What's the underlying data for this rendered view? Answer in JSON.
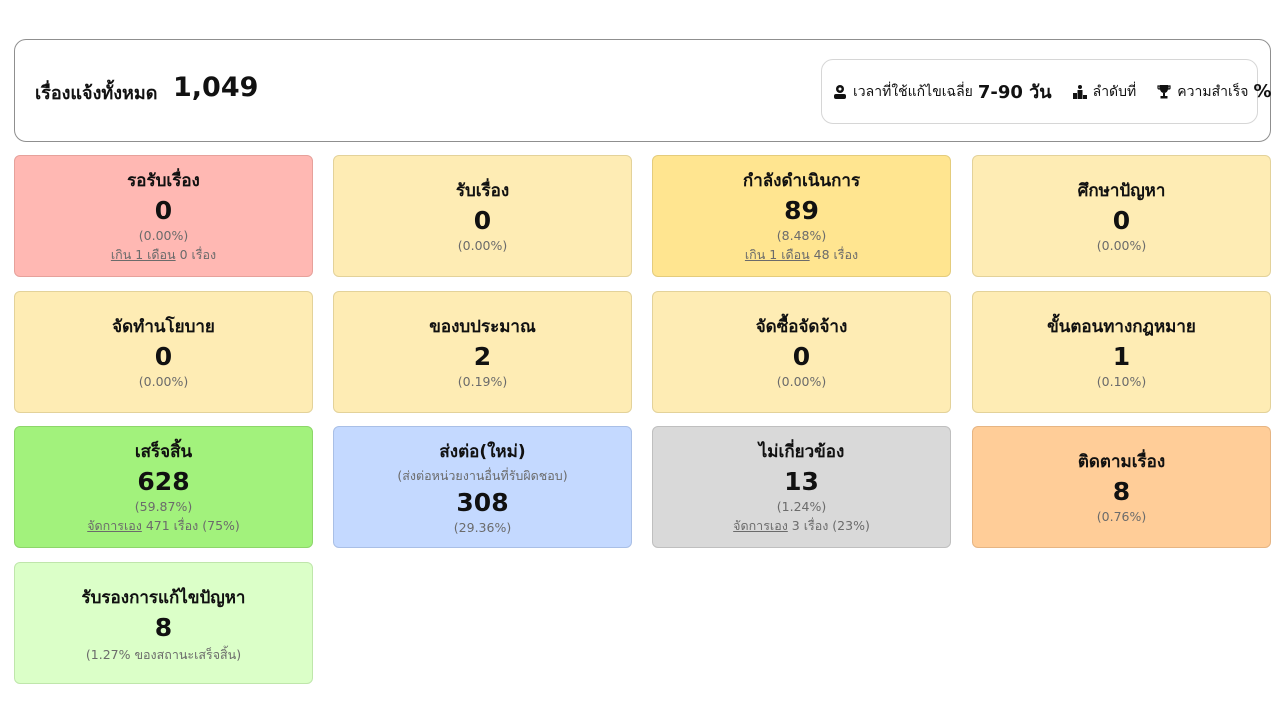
{
  "header": {
    "total_label": "เรื่องแจ้งทั้งหมด",
    "total_value": "1,049",
    "avg_time_label": "เวลาที่ใช้แก้ไขเฉลี่ย",
    "avg_time_value": "7-90 วัน",
    "rank_label": "ลำดับที่",
    "success_label": "ความสำเร็จ",
    "success_value": "%"
  },
  "cards": [
    {
      "title": "รอรับเรื่อง",
      "value": "0",
      "pct": "(0.00%)",
      "sub_link": "เกิน 1 เดือน",
      "sub_text": " 0 เรื่อง"
    },
    {
      "title": "รับเรื่อง",
      "value": "0",
      "pct": "(0.00%)"
    },
    {
      "title": "กำลังดำเนินการ",
      "value": "89",
      "pct": "(8.48%)",
      "sub_link": "เกิน 1 เดือน",
      "sub_text": " 48 เรื่อง"
    },
    {
      "title": "ศึกษาปัญหา",
      "value": "0",
      "pct": "(0.00%)"
    },
    {
      "title": "จัดทำนโยบาย",
      "value": "0",
      "pct": "(0.00%)"
    },
    {
      "title": "ของบประมาณ",
      "value": "2",
      "pct": "(0.19%)"
    },
    {
      "title": "จัดซื้อจัดจ้าง",
      "value": "0",
      "pct": "(0.00%)"
    },
    {
      "title": "ขั้นตอนทางกฎหมาย",
      "value": "1",
      "pct": "(0.10%)"
    },
    {
      "title": "เสร็จสิ้น",
      "value": "628",
      "pct": "(59.87%)",
      "sub_link": "จัดการเอง",
      "sub_text": " 471 เรื่อง (75%)"
    },
    {
      "title": "ส่งต่อ(ใหม่)",
      "subtitle": "(ส่งต่อหน่วยงานอื่นที่รับผิดชอบ)",
      "value": "308",
      "pct": "(29.36%)"
    },
    {
      "title": "ไม่เกี่ยวข้อง",
      "value": "13",
      "pct": "(1.24%)",
      "sub_link": "จัดการเอง",
      "sub_text": " 3 เรื่อง (23%)"
    },
    {
      "title": "ติดตามเรื่อง",
      "value": "8",
      "pct": "(0.76%)"
    },
    {
      "title": "รับรองการแก้ไขปัญหา",
      "value": "8",
      "pct": "(1.27% ของสถานะเสร็จสิ้น)"
    }
  ],
  "colors": {
    "waiting": "#ffb8b3",
    "pending": "#feecb4",
    "in_progress": "#ffe590",
    "done": "#a2f27c",
    "forwarded": "#c4d9ff",
    "unrelated": "#d9d9d9",
    "follow_up": "#ffcd98",
    "certified": "#dbffc8"
  },
  "icons": {
    "avg_time": "user-clock-icon",
    "rank": "ranking-podium-icon",
    "success": "trophy-icon"
  }
}
